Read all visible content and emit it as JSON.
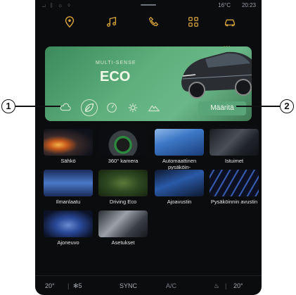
{
  "status": {
    "signals": "⊿ ᛒ ☼ ⚲",
    "temp": "16°C",
    "time": "20:23"
  },
  "nav": {
    "items": [
      "location-icon",
      "music-icon",
      "phone-icon",
      "apps-icon",
      "car-icon"
    ],
    "active": "car-icon"
  },
  "banner": {
    "brand": "MULTI-SENSE",
    "mode": "ECO",
    "define_label": "Määritä"
  },
  "modes": [
    "cloud-icon",
    "leaf-icon",
    "gauge-icon",
    "gear-icon",
    "mountain-icon"
  ],
  "tiles": [
    {
      "label": "Sähkö"
    },
    {
      "label": "360° kamera"
    },
    {
      "label": "Automaattinen pysäköin-\ntiavustin"
    },
    {
      "label": "Istuimet"
    },
    {
      "label": "Ilmanlaatu"
    },
    {
      "label": "Driving Eco"
    },
    {
      "label": "Ajoavustin"
    },
    {
      "label": "Pysäköinnin avustin"
    },
    {
      "label": "Ajoneuvo"
    },
    {
      "label": "Asetukset"
    }
  ],
  "bottom": {
    "left_temp": "20",
    "fan": "5",
    "sync": "SYNC",
    "ac": "A/C",
    "right_temp": "20"
  },
  "callouts": {
    "one": "1",
    "two": "2"
  }
}
